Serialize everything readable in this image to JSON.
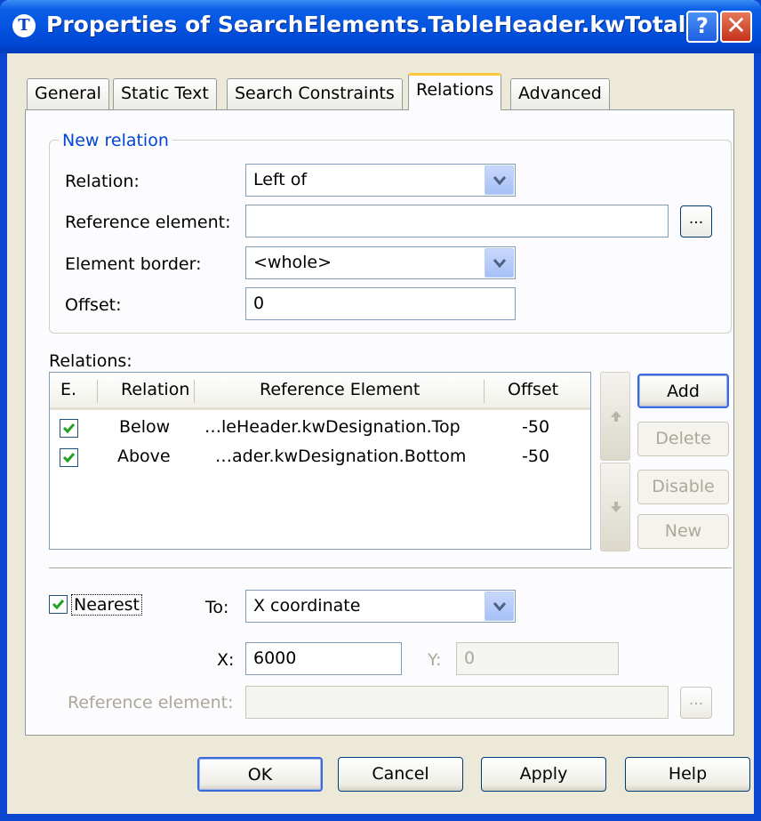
{
  "window": {
    "title": "Properties of SearchElements.TableHeader.kwTotal",
    "app_icon": "T",
    "help_button": "?",
    "close_button": "✕"
  },
  "tabs": [
    {
      "label": "General",
      "active": false
    },
    {
      "label": "Static Text",
      "active": false
    },
    {
      "label": "Search Constraints",
      "active": false
    },
    {
      "label": "Relations",
      "active": true
    },
    {
      "label": "Advanced",
      "active": false
    }
  ],
  "new_relation": {
    "legend": "New relation",
    "relation_label": "Relation:",
    "relation_value": "Left of",
    "reference_label": "Reference element:",
    "reference_value": "",
    "reference_browse": "...",
    "border_label": "Element border:",
    "border_value": "<whole>",
    "offset_label": "Offset:",
    "offset_value": "0"
  },
  "relations": {
    "label": "Relations:",
    "columns": [
      "E.",
      "Relation",
      "Reference Element",
      "Offset"
    ],
    "rows": [
      {
        "enabled": true,
        "relation": "Below",
        "reference": "…leHeader.kwDesignation.Top",
        "offset": "-50"
      },
      {
        "enabled": true,
        "relation": "Above",
        "reference": "…ader.kwDesignation.Bottom",
        "offset": "-50"
      }
    ],
    "buttons": {
      "add": "Add",
      "delete": "Delete",
      "disable": "Disable",
      "new": "New"
    },
    "move_up_icon": "arrow-up-icon",
    "move_down_icon": "arrow-down-icon"
  },
  "nearest": {
    "checkbox_label": "Nearest",
    "checked": true,
    "to_label": "To:",
    "to_value": "X coordinate",
    "x_label": "X:",
    "x_value": "6000",
    "y_label": "Y:",
    "y_value": "0",
    "reference_label": "Reference element:",
    "reference_value": "",
    "reference_browse": "..."
  },
  "footer": {
    "ok": "OK",
    "cancel": "Cancel",
    "apply": "Apply",
    "help": "Help"
  },
  "colors": {
    "title_bar": "#0a46d0",
    "legend": "#0046d5",
    "active_tab_accent": "#ffc83c",
    "check": "#21a121"
  }
}
